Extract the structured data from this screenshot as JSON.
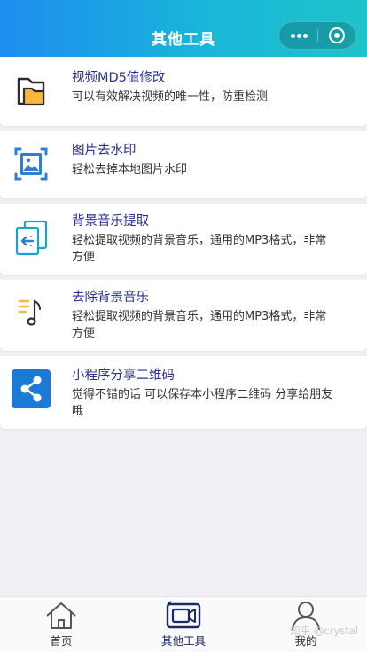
{
  "header": {
    "title": "其他工具",
    "background": [
      "#1e8cf0",
      "#1ec3c9"
    ]
  },
  "tools": [
    {
      "icon": "folder-icon",
      "title": "视频MD5值修改",
      "desc": "可以有效解决视频的唯一性，防重检测"
    },
    {
      "icon": "image-frame-icon",
      "title": "图片去水印",
      "desc": "轻松去掉本地图片水印"
    },
    {
      "icon": "extract-file-icon",
      "title": "背景音乐提取",
      "desc": "轻松提取视频的背景音乐，通用的MP3格式，非常方便"
    },
    {
      "icon": "music-list-icon",
      "title": "去除背景音乐",
      "desc": "轻松提取视频的背景音乐，通用的MP3格式，非常方便"
    },
    {
      "icon": "share-icon",
      "title": "小程序分享二维码",
      "desc": "觉得不错的话 可以保存本小程序二维码 分享给朋友哦"
    }
  ],
  "tabbar": {
    "tabs": [
      {
        "label": "首页",
        "icon": "home-icon",
        "active": false
      },
      {
        "label": "其他工具",
        "icon": "camera-tool-icon",
        "active": true
      },
      {
        "label": "我的",
        "icon": "user-icon",
        "active": false
      }
    ],
    "active_color": "#1b2a6b"
  },
  "watermark": "知乎 @crystal"
}
